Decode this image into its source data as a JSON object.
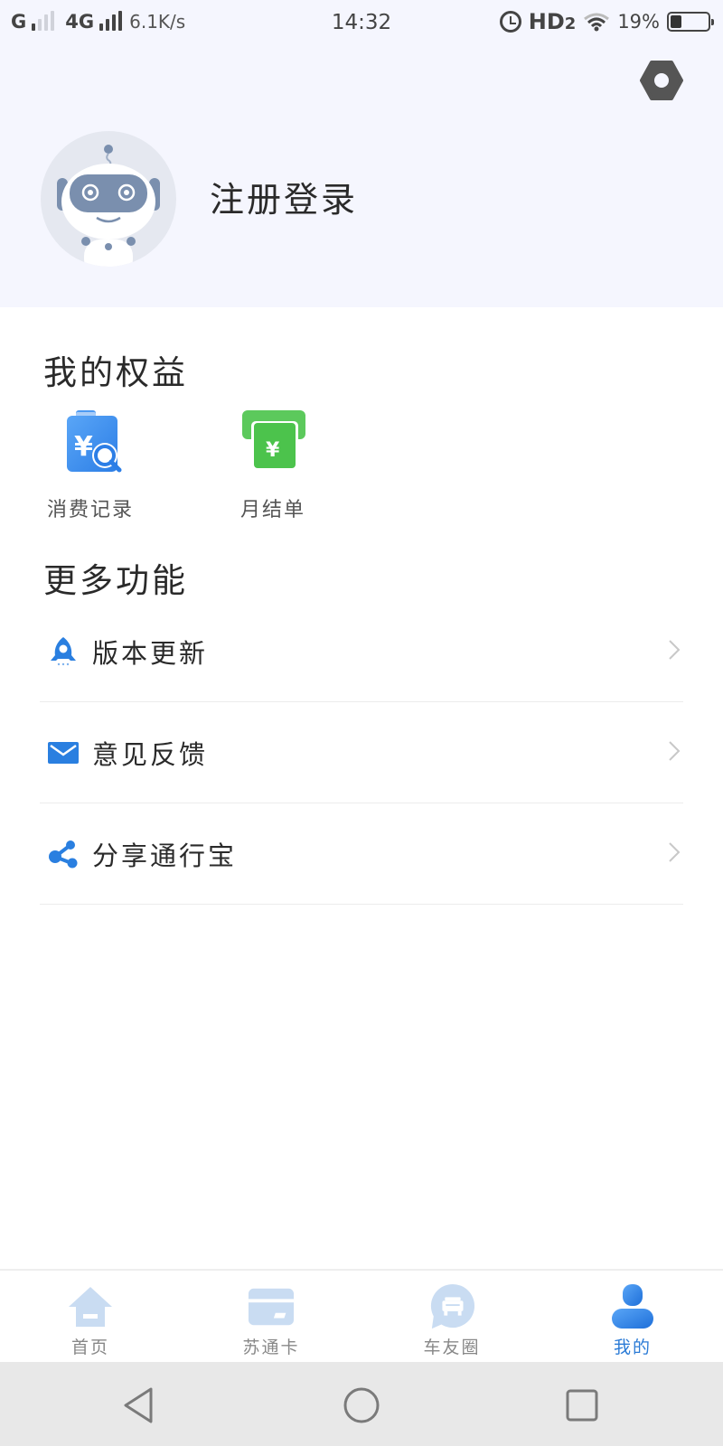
{
  "status_bar": {
    "network1": "G",
    "network2": "4G",
    "speed": "6.1K/s",
    "time": "14:32",
    "hd": "HD",
    "hd_sub": "2",
    "battery_text": "19%",
    "battery_level": 0.19
  },
  "header": {
    "settings_icon": "settings-hex-icon",
    "avatar_icon": "robot-avatar",
    "login_label": "注册登录"
  },
  "benefits": {
    "title": "我的权益",
    "items": [
      {
        "label": "消费记录",
        "icon": "receipt-search-icon",
        "color": "#3d8ef0"
      },
      {
        "label": "月结单",
        "icon": "monthly-bill-icon",
        "color": "#4cc34c"
      }
    ]
  },
  "more": {
    "title": "更多功能",
    "items": [
      {
        "label": "版本更新",
        "icon": "rocket-icon"
      },
      {
        "label": "意见反馈",
        "icon": "mail-icon"
      },
      {
        "label": "分享通行宝",
        "icon": "share-icon"
      }
    ]
  },
  "tabbar": {
    "tabs": [
      {
        "label": "首页",
        "icon": "home-icon",
        "active": false
      },
      {
        "label": "苏通卡",
        "icon": "card-icon",
        "active": false
      },
      {
        "label": "车友圈",
        "icon": "car-chat-icon",
        "active": false
      },
      {
        "label": "我的",
        "icon": "user-icon",
        "active": true
      }
    ]
  },
  "colors": {
    "accent": "#2b7bd6",
    "icon_blue": "#2a7fe0",
    "inactive_tab_icon": "#c9dcf2",
    "header_bg": "#f5f6fe"
  }
}
